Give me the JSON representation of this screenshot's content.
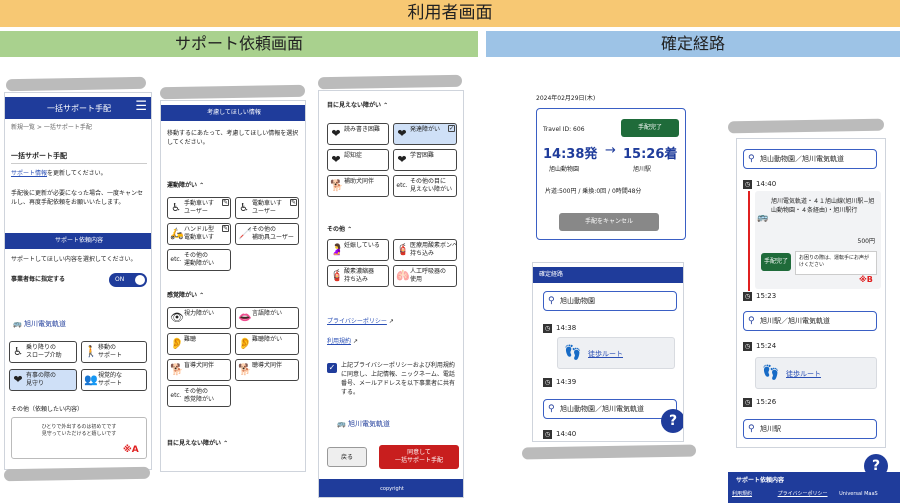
{
  "header": {
    "title": "利用者画面",
    "section_left": "サポート依頼画面",
    "section_right": "確定経路"
  },
  "colors": {
    "navy": "#1f3c9b",
    "green": "#1f6b3a",
    "red": "#c81e1e",
    "header": "#f7c873",
    "left": "#a9d18e",
    "right": "#9dc3e6"
  },
  "p1": {
    "app_title": "一括サポート手配",
    "menu_icon": "menu-icon",
    "breadcrumb": "新規一覧 > 一括サポート手配",
    "heading": "一括サポート手配",
    "link_text": "サポート情報",
    "link_tail": "を更新してください。",
    "note": "手配後に更新が必要になった場合、一度キャンセルし、再度手配依頼をお願いいたします。",
    "section_bar": "サポート依頼内容",
    "select_note": "サポートしてほしい内容を選択してください。",
    "toggle_label": "事業者毎に指定する",
    "toggle_state": "ON",
    "operator": "旭川電気軌道",
    "chips": [
      {
        "label": "乗り降りの\nスロープ介助",
        "icon": "♿",
        "selected": false
      },
      {
        "label": "移動の\nサポート",
        "icon": "🧑‍🦯",
        "selected": false
      },
      {
        "label": "有事の際の\n見守り",
        "icon": "❤",
        "selected": true
      },
      {
        "label": "視覚的な\nサポート",
        "icon": "👫",
        "selected": false
      }
    ],
    "other_label": "その他（依頼したい内容）",
    "other_text": "ひとりで外出するのは初めてです\n見守っていただけると嬉しいです",
    "mark": "※A"
  },
  "p2": {
    "section_bar": "考慮してほしい情報",
    "desc": "移動するにあたって、考慮してほしい情報を選択してください。",
    "group1": "運動障がい",
    "group1_chips": [
      "手動車いす\nユーザー",
      "電動車いす\nユーザー",
      "ハンドル型\n電動車いす",
      "その他の\n補助具ユーザー",
      "その他の\n運動障がい"
    ],
    "group2": "感覚障がい",
    "group2_chips": [
      "視力障がい",
      "言語障がい",
      "難聴",
      "難聴障がい",
      "盲導犬同伴",
      "聴導犬同伴",
      "その他の\n感覚障がい"
    ],
    "group3": "目に見えない障がい"
  },
  "p3": {
    "group3": "目に見えない障がい",
    "group3_chips": [
      "読み書き困難",
      "発達障がい",
      "認知症",
      "学習困難",
      "補助犬同伴",
      "その他の目に\n見えない障がい"
    ],
    "group4": "その他",
    "group4_chips": [
      "妊娠している",
      "医療用酸素ボンベ\n持ち込み",
      "酸素濃縮器\n持ち込み",
      "人工呼吸器の\n使用"
    ],
    "privacy_link": "プライバシーポリシー",
    "terms_link": "利用規約",
    "consent": "上記プライバシーポリシーおよび利用規約に同意し、上記情報、ニックネーム、電話番号、メールアドレスを以下事業者に共有する。",
    "operator": "旭川電気軌道",
    "back_btn": "戻る",
    "agree_btn": "同意して\n一括サポート手配",
    "footer": "copyright"
  },
  "p4": {
    "date": "2024年02月29日(木)",
    "travel_id": "Travel ID: 606",
    "status_btn": "手配完了",
    "depart_time": "14:38発",
    "arrive_time": "15:26着",
    "depart_place": "旭山動物園",
    "arrive_place": "旭川駅",
    "fare": "片道:500円 / 乗換:0回 / 0時間48分",
    "cancel_btn": "手配をキャンセル",
    "route_bar": "確定経路",
    "stops": [
      "旭山動物園",
      "旭山動物園／旭川電気軌道"
    ],
    "times": [
      "14:38",
      "14:39",
      "14:40"
    ],
    "walk": "徒歩ルート"
  },
  "p5": {
    "stop1": "旭山動物園／旭川電気軌道",
    "time1": "14:40",
    "transit": "旭川電気軌道・４１旭山線(旭川駅−旭山動物園・４条経由)・旭川駅行",
    "price": "500円",
    "done_btn": "手配完了",
    "done_note": "お困りの際は、運転手にお声がけください",
    "mark": "※B",
    "time2": "15:23",
    "stop2": "旭川駅／旭川電気軌道",
    "time3": "15:24",
    "walk": "徒歩ルート",
    "time4": "15:26",
    "stop3": "旭川駅",
    "section_bar": "サポート依頼内容",
    "footer_links": [
      "利用規約",
      "プライバシーポリシー",
      "Universal MaaS"
    ]
  }
}
